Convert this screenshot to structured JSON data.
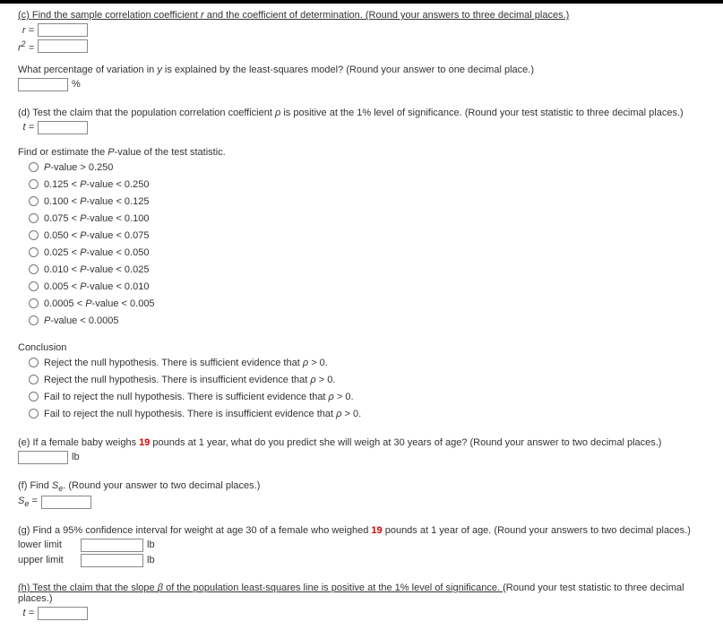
{
  "c": {
    "prompt_prefix": "(c) ",
    "prompt": "Find the sample correlation coefficient ",
    "prompt_mid": " and the coefficient of determination. (Round your answers to three decimal places.)",
    "r_var": "r",
    "r_label": "r =",
    "r2_label_base": "r",
    "r2_sup": "2",
    "r2_eq": " =",
    "variation_q_prefix": "What percentage of variation in ",
    "variation_y": "y",
    "variation_q_suffix": " is explained by the least-squares model? (Round your answer to one decimal place.)",
    "percent": "%"
  },
  "d": {
    "prompt_prefix": "(d) Test the claim that the population correlation coefficient ",
    "rho": "ρ",
    "prompt_suffix": " is positive at the 1% level of significance. (Round your test statistic to three decimal places.)",
    "t_label": "t =",
    "pval_heading_prefix": "Find or estimate the ",
    "pval_P": "P",
    "pval_heading_suffix": "-value of the test statistic.",
    "options": [
      "P-value > 0.250",
      "0.125 < P-value < 0.250",
      "0.100 < P-value < 0.125",
      "0.075 < P-value < 0.100",
      "0.050 < P-value < 0.075",
      "0.025 < P-value < 0.050",
      "0.010 < P-value < 0.025",
      "0.005 < P-value < 0.010",
      "0.0005 < P-value < 0.005",
      "P-value < 0.0005"
    ],
    "conclusion_heading": "Conclusion",
    "conclusion_opts": [
      "Reject the null hypothesis. There is sufficient evidence that ρ > 0.",
      "Reject the null hypothesis. There is insufficient evidence that ρ > 0.",
      "Fail to reject the null hypothesis. There is sufficient evidence that ρ > 0.",
      "Fail to reject the null hypothesis. There is insufficient evidence that ρ > 0."
    ]
  },
  "e": {
    "prompt_prefix": "(e) If a female baby weighs ",
    "weight": "19",
    "prompt_suffix": " pounds at 1 year, what do you predict she will weigh at 30 years of age? (Round your answer to two decimal places.)",
    "unit": "lb"
  },
  "f": {
    "prompt_prefix": "(f) Find ",
    "Se_S": "S",
    "Se_e": "e",
    "prompt_suffix": ". (Round your answer to two decimal places.)",
    "Se_label_S": "S",
    "Se_label_e": "e",
    "Se_eq": " ="
  },
  "g": {
    "prompt_prefix": "(g) Find a 95% confidence interval for weight at age 30 of a female who weighed ",
    "weight": "19",
    "prompt_suffix": " pounds at 1 year of age. (Round your answers to two decimal places.)",
    "lower_label": "lower limit",
    "upper_label": "upper limit",
    "unit": "lb"
  },
  "h": {
    "prompt_prefix": "(h) Test the claim that the slope ",
    "beta": "β",
    "prompt_suffix": " of the population least-squares line is positive at the 1% level of significance. (Round your test statistic to three decimal places.)",
    "t_label": "t ="
  }
}
